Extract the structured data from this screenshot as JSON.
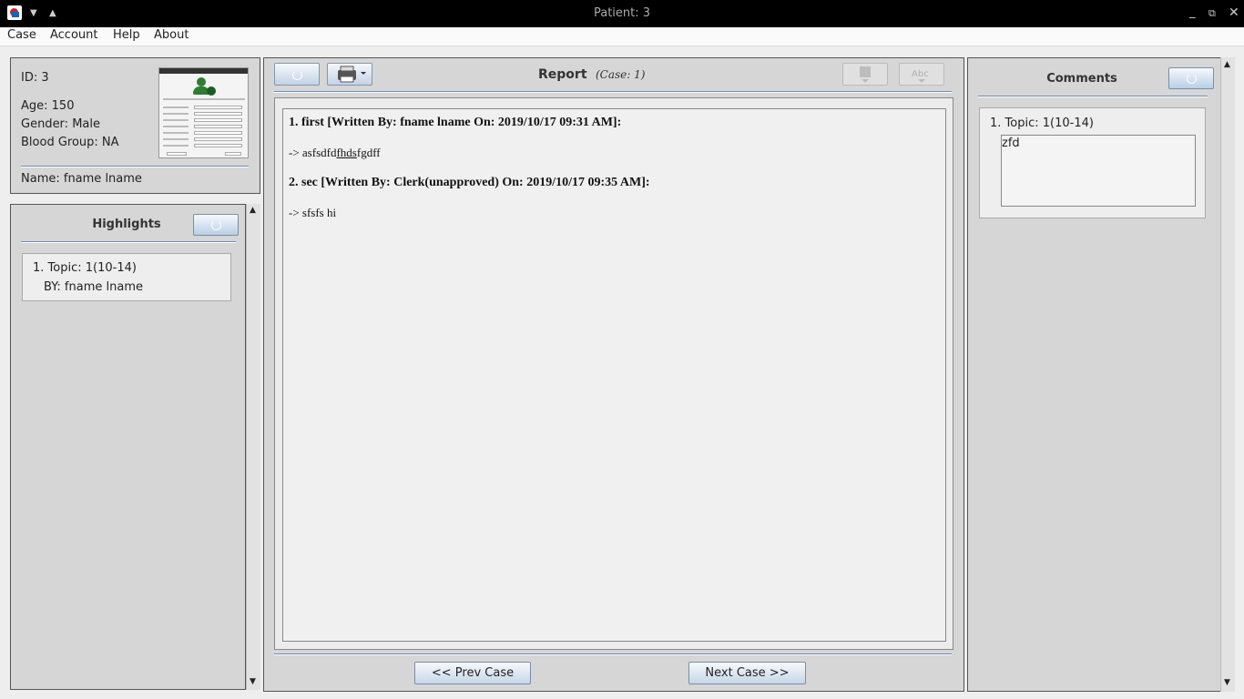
{
  "window": {
    "title": "Patient: 3"
  },
  "menu": {
    "items": [
      "Case",
      "Account",
      "Help",
      "About"
    ]
  },
  "patient": {
    "id_line": "ID: 3",
    "age_line": "Age: 150",
    "gender_line": "Gender: Male",
    "blood_line": "Blood Group: NA",
    "name_line": "Name: fname lname"
  },
  "highlights": {
    "heading": "Highlights",
    "items": [
      {
        "topic": "1. Topic: 1(10-14)",
        "by": "BY: fname lname"
      }
    ]
  },
  "report": {
    "heading": "Report",
    "case_label": "(Case: 1)",
    "entries": [
      {
        "title": "1. first [Written By: fname lname On: 2019/10/17 09:31 AM]:",
        "text_prefix": "-> asfsdfd",
        "text_underlined": "fhds",
        "text_suffix": "fgdff"
      },
      {
        "title": "2. sec [Written By: Clerk(unapproved) On: 2019/10/17 09:35 AM]:",
        "text": "-> sfsfs hi"
      }
    ],
    "prev_label": "<< Prev Case",
    "next_label": "Next Case >>"
  },
  "comments": {
    "heading": "Comments",
    "items": [
      {
        "topic": "1. Topic: 1(10-14)",
        "text": "zfd"
      }
    ]
  },
  "icons": {
    "app": "app-icon",
    "refresh": "refresh-icon",
    "print": "printer-icon",
    "bookmark": "bookmark-icon",
    "spellcheck": "spellcheck-icon"
  }
}
